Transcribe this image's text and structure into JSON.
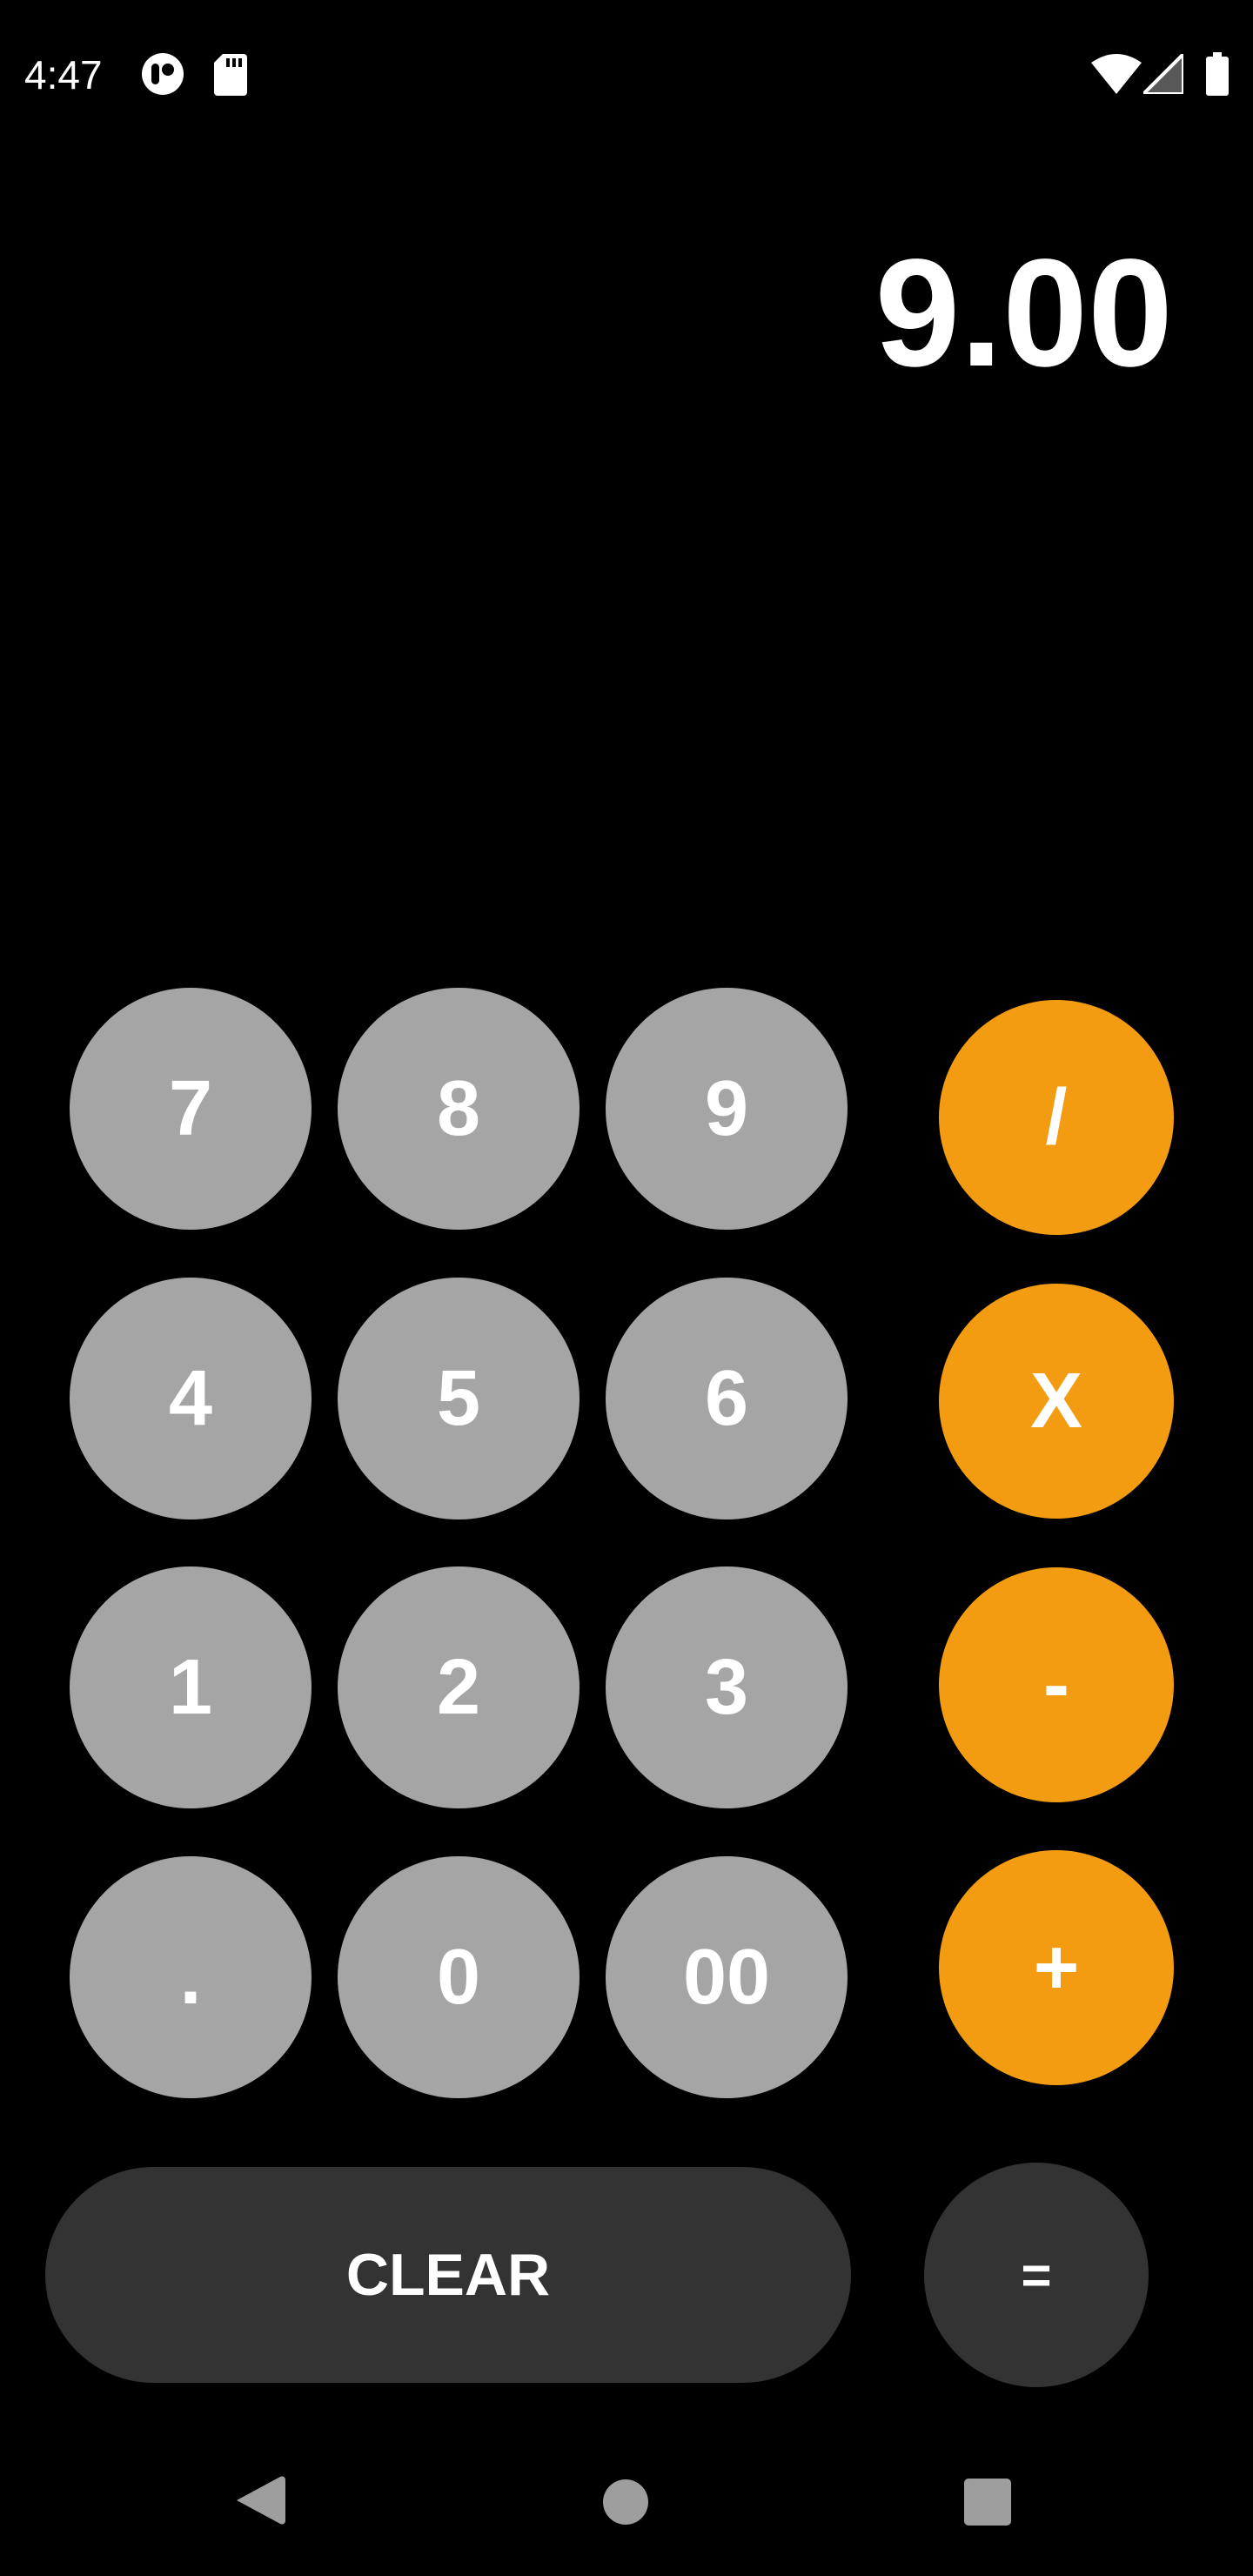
{
  "status_bar": {
    "time": "4:47",
    "icons": [
      "media-icon",
      "sd-card-icon",
      "wifi-icon",
      "signal-icon",
      "battery-icon"
    ]
  },
  "display": {
    "value": "9.00"
  },
  "keypad": {
    "rows": [
      [
        "7",
        "8",
        "9"
      ],
      [
        "4",
        "5",
        "6"
      ],
      [
        "1",
        "2",
        "3"
      ],
      [
        ".",
        "0",
        "00"
      ]
    ]
  },
  "operators": {
    "divide": "/",
    "multiply": "X",
    "subtract": "-",
    "add": "+",
    "equals": "="
  },
  "clear_label": "CLEAR",
  "nav_bar": {
    "icons": [
      "back-icon",
      "home-icon",
      "recents-icon"
    ]
  },
  "colors": {
    "background": "#000000",
    "number_key": "#a5a5a5",
    "operator_key": "#f39c12",
    "dark_key": "#333333",
    "text": "#ffffff"
  }
}
